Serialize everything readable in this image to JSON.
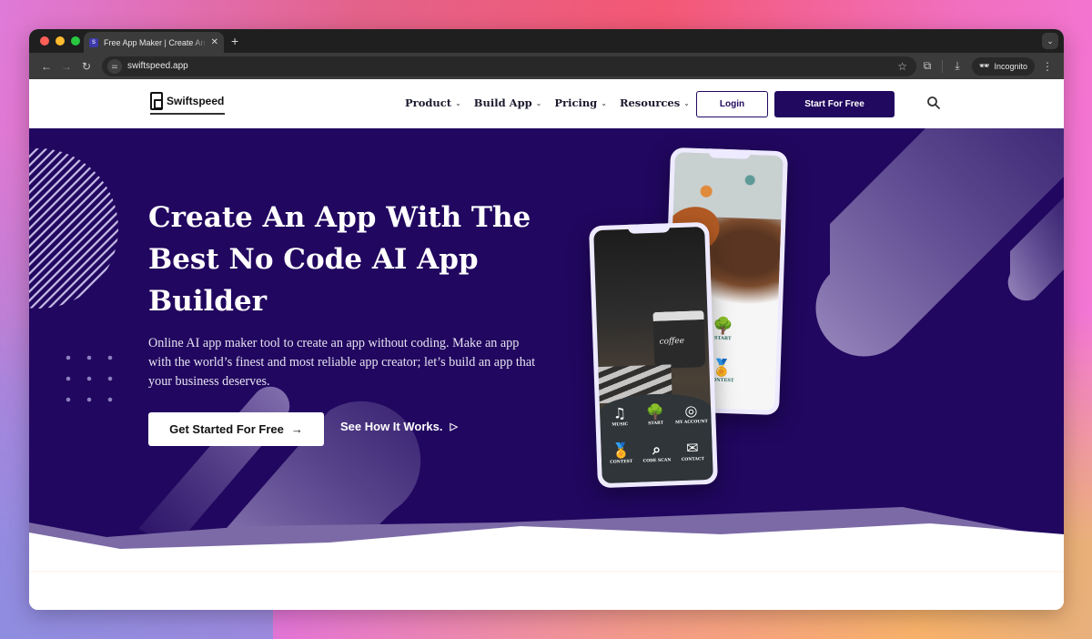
{
  "browser": {
    "tab": {
      "favicon": "S",
      "title": "Free App Maker | Create An App With The Best No Code AI App Builder",
      "close_glyph": "✕"
    },
    "new_tab_glyph": "+",
    "tab_menu_glyph": "⌄",
    "nav": {
      "back": "←",
      "forward": "→",
      "reload": "↻"
    },
    "address": {
      "url": "swiftspeed.app",
      "site_info_glyph": "⚌"
    },
    "bookmark_glyph": "☆",
    "extensions_glyph": "⧉",
    "download_glyph": "⤓",
    "incognito": {
      "glyph": "🕶",
      "label": "Incognito"
    },
    "menu_glyph": "⋮"
  },
  "site": {
    "logo_text": "Swiftspeed",
    "nav": [
      {
        "label": "Product",
        "chevron": "⌄"
      },
      {
        "label": "Build App",
        "chevron": "⌄"
      },
      {
        "label": "Pricing",
        "chevron": "⌄"
      },
      {
        "label": "Resources",
        "chevron": "⌄"
      }
    ],
    "login_label": "Login",
    "start_label": "Start For Free",
    "colors": {
      "brand": "#21075f",
      "accent_light": "#7b6aa6"
    }
  },
  "hero": {
    "title": "Create An App With The Best No Code AI App Builder",
    "description": "Online AI app maker tool to create an app without coding. Make an app with the world’s finest and most reliable app creator; let’s build an app that your business deserves.",
    "cta_label": "Get Started For Free",
    "cta_arrow": "→",
    "secondary_label": "See How It Works.",
    "secondary_glyph": "▷",
    "phone_back": {
      "items": [
        {
          "glyph": "🌳",
          "label": "START"
        },
        {
          "glyph": "🏅",
          "label": "CONTEST"
        }
      ]
    },
    "phone_front": {
      "cup_text": "coffee",
      "menu": [
        {
          "glyph": "♫",
          "label": "MUSIC"
        },
        {
          "glyph": "🌳",
          "label": "START"
        },
        {
          "glyph": "◎",
          "label": "MY ACCOUNT"
        },
        {
          "glyph": "🏅",
          "label": "CONTEST"
        },
        {
          "glyph": "⌕",
          "label": "CODE SCAN"
        },
        {
          "glyph": "✉",
          "label": "CONTACT"
        }
      ]
    }
  }
}
